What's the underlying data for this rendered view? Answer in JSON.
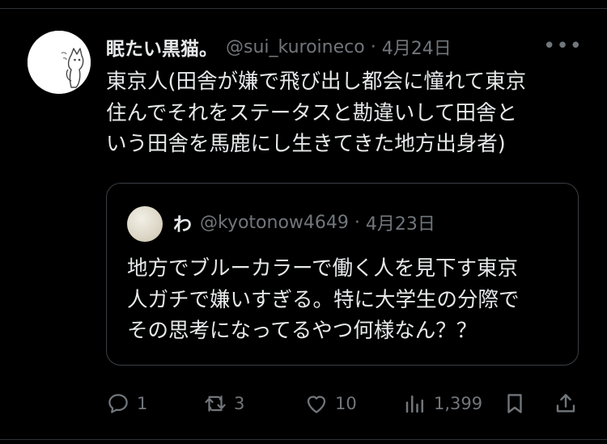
{
  "tweet": {
    "author_name": "眠たい黒猫。",
    "handle": "@sui_kuroineco",
    "separator": "·",
    "date": "4月24日",
    "more_label": "•••",
    "lines": [
      "東京人(田舎が嫌で飛び出し都会に憧れて東京",
      "住んでそれをステータスと勘違いして田舎と",
      "いう田舎を馬鹿にし生きてきた地方出身者)"
    ]
  },
  "quoted": {
    "author_name": "わ",
    "handle": "@kyotonow4649",
    "separator": "·",
    "date": "4月23日",
    "lines": [
      "地方でブルーカラーで働く人を見下す東京",
      "人ガチで嫌いすぎる。特に大学生の分際で",
      "その思考になってるやつ何様なん？？"
    ]
  },
  "actions": {
    "reply_count": "1",
    "retweet_count": "3",
    "like_count": "10",
    "views_count": "1,399",
    "icons": [
      "reply-icon",
      "retweet-icon",
      "like-icon",
      "views-icon",
      "bookmark-icon",
      "share-icon"
    ]
  },
  "colors": {
    "background": "#000000",
    "text": "#e7e9ea",
    "muted": "#71767b",
    "border": "#3a3f44"
  }
}
